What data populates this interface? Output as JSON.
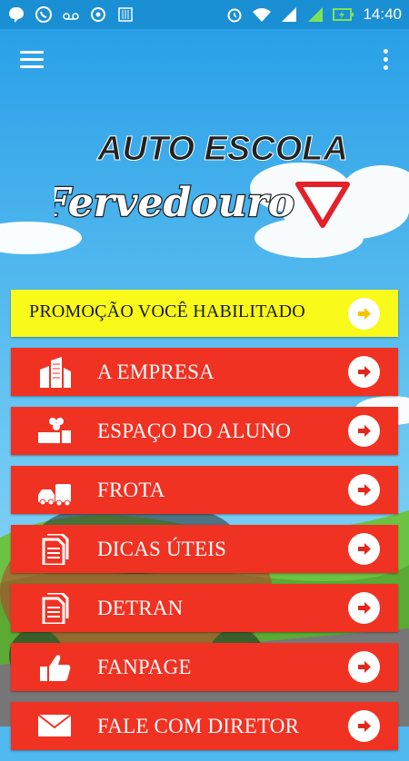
{
  "status_bar": {
    "time": "14:40",
    "icons": [
      "chat-bubble-icon",
      "whatsapp-icon",
      "voicemail-icon",
      "camera-icon",
      "barcode-icon",
      "alarm-icon",
      "wifi-icon",
      "sim1-signal-icon",
      "sim2-signal-icon",
      "battery-charging-icon"
    ]
  },
  "app_bar": {
    "menu_icon": "hamburger-icon",
    "overflow_icon": "more-vert-icon"
  },
  "logo": {
    "line1": "AUTO ESCOLA",
    "line2": "Fervedouro"
  },
  "menu": {
    "promo": "PROMOÇÃO VOCÊ HABILITADO",
    "items": [
      {
        "label": "A EMPRESA",
        "icon": "buildings-icon"
      },
      {
        "label": "ESPAÇO DO ALUNO",
        "icon": "students-icon"
      },
      {
        "label": "FROTA",
        "icon": "vehicles-icon"
      },
      {
        "label": "DICAS ÚTEIS",
        "icon": "document-icon"
      },
      {
        "label": "DETRAN",
        "icon": "document-icon"
      },
      {
        "label": "FANPAGE",
        "icon": "thumbs-up-icon"
      },
      {
        "label": "FALE COM DIRETOR",
        "icon": "envelope-icon"
      }
    ]
  },
  "colors": {
    "status_bar": "#1a8fd4",
    "sky": "#4fb8ee",
    "menu_red": "#f03223",
    "promo_yellow": "#f9f91a"
  }
}
